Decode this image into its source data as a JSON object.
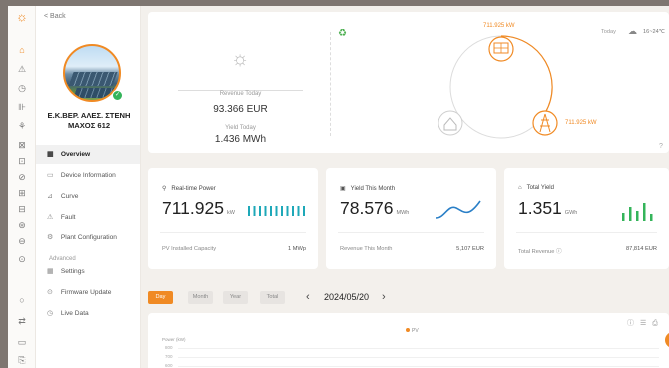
{
  "rail": {
    "logo": "☼",
    "icons": [
      "⌂",
      "⚠",
      "◷",
      "⊪",
      "⚘",
      "⊠",
      "⊡",
      "⊘",
      "⊞",
      "⊟",
      "⊛",
      "⊖",
      "⊙",
      "○",
      "⇄",
      "▭",
      "⎘"
    ]
  },
  "menu": {
    "back_label": "< Back",
    "site_name": "Ε.Κ.ΒΕΡ. ΑΛΕΣ. ΣΤΕΝΗ ΜΑΧΟΣ 612",
    "items": [
      {
        "label": "Overview",
        "icon": "▦"
      },
      {
        "label": "Device Information",
        "icon": "▭"
      },
      {
        "label": "Curve",
        "icon": "⊿"
      },
      {
        "label": "Fault",
        "icon": "⚠"
      },
      {
        "label": "Plant Configuration",
        "icon": "⚙"
      }
    ],
    "advanced_label": "Advanced",
    "advanced_items": [
      {
        "label": "Settings",
        "icon": "▦"
      },
      {
        "label": "Firmware Update",
        "icon": "⊙"
      },
      {
        "label": "Live Data",
        "icon": "◷"
      }
    ]
  },
  "summary": {
    "revenue_label": "Revenue Today",
    "revenue_value": "93.366 EUR",
    "yield_label": "Yield Today",
    "yield_value": "1.436 MWh",
    "date": "Today",
    "temperature": "16~24℃",
    "flow_pv_value": "711.925 kW",
    "flow_grid_value": "711.925 kW"
  },
  "kpis": [
    {
      "title": "Real-time Power",
      "value": "711.925",
      "unit": "kW",
      "foot_label": "PV Installed Capacity",
      "foot_value": "1 MWp"
    },
    {
      "title": "Yield This Month",
      "value": "78.576",
      "unit": "MWh",
      "foot_label": "Revenue This Month",
      "foot_value": "5,107 EUR"
    },
    {
      "title": "Total Yield",
      "value": "1.351",
      "unit": "GWh",
      "foot_label": "Total Revenue ⓘ",
      "foot_value": "87,814 EUR"
    }
  ],
  "period_tabs": [
    "Day",
    "Month",
    "Year",
    "Total"
  ],
  "selected_date": "2024/05/20",
  "chart": {
    "legend": "PV",
    "ylabel": "Power (kW)",
    "yticks": [
      "800",
      "700",
      "600"
    ]
  },
  "colors": {
    "accent": "#f08a24",
    "line": "#2a7fc7",
    "bars": "#34b45a"
  }
}
